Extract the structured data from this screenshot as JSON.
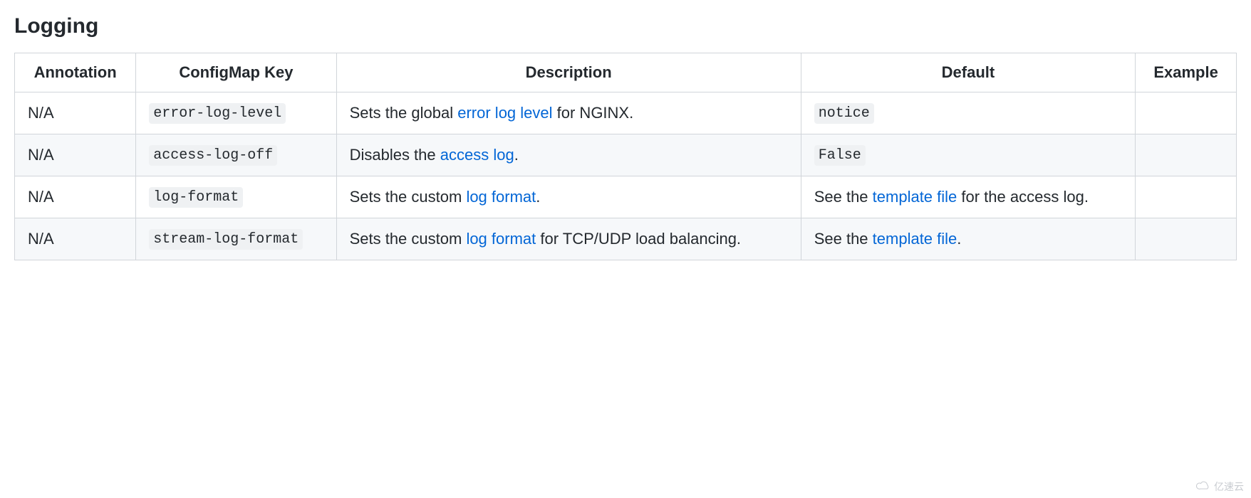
{
  "heading": "Logging",
  "headers": {
    "annotation": "Annotation",
    "configmap_key": "ConfigMap Key",
    "description": "Description",
    "default": "Default",
    "example": "Example"
  },
  "rows": [
    {
      "annotation": "N/A",
      "configmap_key": "error-log-level",
      "description": {
        "pre": "Sets the global ",
        "link": "error log level",
        "post": " for NGINX."
      },
      "default": {
        "code": "notice"
      },
      "example": ""
    },
    {
      "annotation": "N/A",
      "configmap_key": "access-log-off",
      "description": {
        "pre": "Disables the ",
        "link": "access log",
        "post": "."
      },
      "default": {
        "code": "False"
      },
      "example": ""
    },
    {
      "annotation": "N/A",
      "configmap_key": "log-format",
      "description": {
        "pre": "Sets the custom ",
        "link": "log format",
        "post": "."
      },
      "default": {
        "pre": "See the ",
        "link": "template file",
        "post": " for the access log."
      },
      "example": ""
    },
    {
      "annotation": "N/A",
      "configmap_key": "stream-log-format",
      "description": {
        "pre": "Sets the custom ",
        "link": "log format",
        "post": " for TCP/UDP load balancing."
      },
      "default": {
        "pre": "See the ",
        "link": "template file",
        "post": "."
      },
      "example": ""
    }
  ],
  "watermark": "亿速云"
}
